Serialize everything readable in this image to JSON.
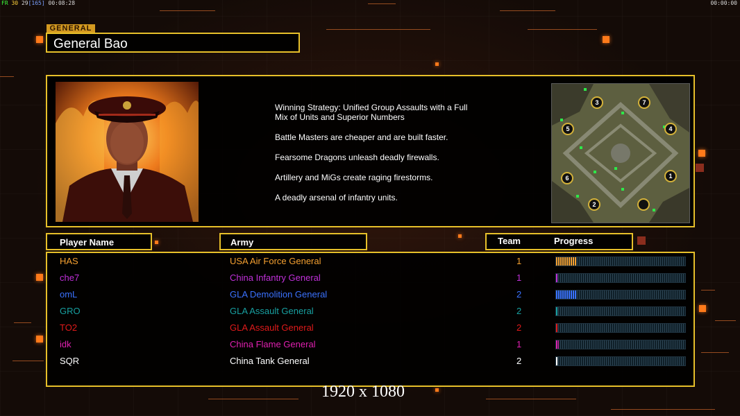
{
  "hud": {
    "fps_label": "FR",
    "fps": "30",
    "frame": "29",
    "frame_extra": "[165]",
    "time_left": "00:08:28",
    "time_right": "00:00:00"
  },
  "general": {
    "section_label": "GENERAL",
    "name": "General Bao"
  },
  "description": [
    "Winning Strategy: Unified Group Assaults with a Full\n Mix of Units and Superior Numbers",
    "Battle Masters are cheaper and are built faster.",
    "Fearsome Dragons unleash deadly firewalls.",
    "Artillery and MiGs create raging firestorms.",
    "A deadly arsenal of infantry units."
  ],
  "map": {
    "spawns": [
      "1",
      "2",
      "3",
      "4",
      "5",
      "6",
      "7"
    ]
  },
  "table": {
    "headers": {
      "player": "Player Name",
      "army": "Army",
      "team": "Team",
      "progress": "Progress"
    },
    "rows": [
      {
        "player": "HAS",
        "army": "USA Air Force General",
        "team": "1",
        "color": "#f5a030",
        "progress": 0.16
      },
      {
        "player": "che7",
        "army": "China Infantry General",
        "team": "1",
        "color": "#c030d8",
        "progress": 0.01
      },
      {
        "player": "omL",
        "army": "GLA Demolition General",
        "team": "2",
        "color": "#3a72ff",
        "progress": 0.16
      },
      {
        "player": "GRO",
        "army": "GLA Assault General",
        "team": "2",
        "color": "#18a0a0",
        "progress": 0.01
      },
      {
        "player": "TO2",
        "army": "GLA Assault General",
        "team": "2",
        "color": "#e01a1a",
        "progress": 0.01
      },
      {
        "player": "idk",
        "army": "China Flame General",
        "team": "1",
        "color": "#e020b0",
        "progress": 0.02
      },
      {
        "player": "SQR",
        "army": "China Tank General",
        "team": "2",
        "color": "#ffffff",
        "progress": 0.01
      }
    ]
  },
  "resolution": "1920 x 1080"
}
